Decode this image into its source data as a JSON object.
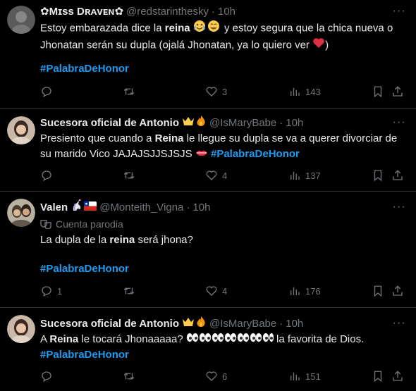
{
  "tweets": [
    {
      "display_name": "✿Mɪss Dʀᴀᴠᴇɴ✿",
      "handle": "@redstarinthesky",
      "dot": "·",
      "time": "10h",
      "more": "···",
      "text_parts": [
        "Estoy embarazada dice la ",
        "reina",
        " ",
        " y estoy segura que la chica nueva o Jhonatan serán su dupla (ojalá Jhonatan, ya lo quiero ver ",
        ")"
      ],
      "hashtag": "#PalabraDeHonor",
      "replies": "",
      "retweets": "",
      "likes": "3",
      "views": "143",
      "avatar_color": "#6b6b6b"
    },
    {
      "display_name": "Sucesora oficial de Antonio",
      "handle": "@IsMaryBabe",
      "dot": "·",
      "time": "10h",
      "more": "···",
      "text_parts": [
        "Presiento que cuando a ",
        "Reina",
        " le llegue su dupla se va a querer divorciar de su marido Vico JAJAJSJJSJSJS "
      ],
      "hashtag": "#PalabraDeHonor",
      "replies": "",
      "retweets": "",
      "likes": "4",
      "views": "137",
      "avatar_color": "#8a6a5a"
    },
    {
      "display_name": "Valen",
      "handle": "@Monteith_Vigna",
      "dot": "·",
      "time": "10h",
      "more": "···",
      "parody_label": "Cuenta parodia",
      "text_parts": [
        "La dupla de la ",
        "reina",
        " será jhona?"
      ],
      "hashtag": "#PalabraDeHonor",
      "replies": "1",
      "retweets": "",
      "likes": "4",
      "views": "176",
      "avatar_color": "#7a7060"
    },
    {
      "display_name": "Sucesora oficial de Antonio",
      "handle": "@IsMaryBabe",
      "dot": "·",
      "time": "10h",
      "more": "···",
      "text_parts": [
        "A ",
        "Reina",
        " le tocará Jhonaaaaa? ",
        " la favorita de Dios."
      ],
      "hashtag": "#PalabraDeHonor",
      "replies": "",
      "retweets": "",
      "likes": "6",
      "views": "151",
      "avatar_color": "#8a6a5a"
    }
  ],
  "colors": {
    "background": "#000000",
    "text": "#e7e9ea",
    "muted": "#71767b",
    "accent": "#1d9bf0",
    "divider": "#2f3336"
  },
  "icons": [
    "reply-icon",
    "retweet-icon",
    "like-icon",
    "views-icon",
    "bookmark-icon",
    "share-icon",
    "more-icon",
    "parody-mask-icon"
  ]
}
